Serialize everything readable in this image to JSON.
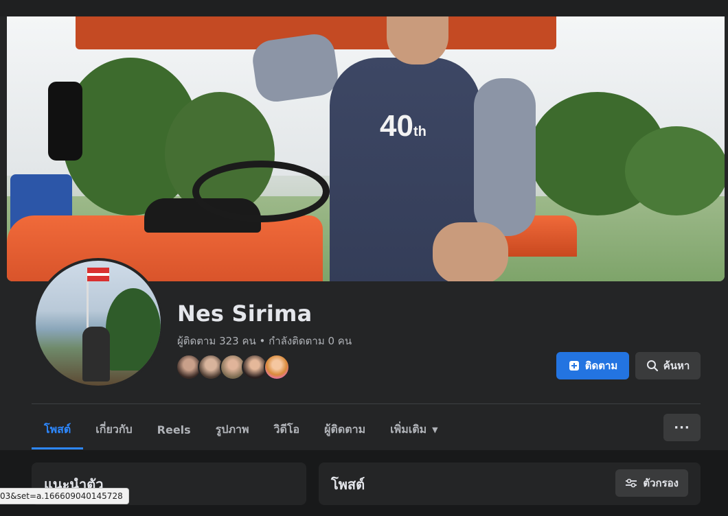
{
  "profile": {
    "name": "Nes Sirima",
    "follow_stats": "ผู้ติดตาม 323 คน • กำลังติดตาม 0 คน"
  },
  "actions": {
    "follow_label": "ติดตาม",
    "search_label": "ค้นหา"
  },
  "tabs": [
    {
      "label": "โพสต์",
      "active": true
    },
    {
      "label": "เกี่ยวกับ",
      "active": false
    },
    {
      "label": "Reels",
      "active": false
    },
    {
      "label": "รูปภาพ",
      "active": false
    },
    {
      "label": "วิดีโอ",
      "active": false
    },
    {
      "label": "ผู้ติดตาม",
      "active": false
    },
    {
      "label": "เพิ่มเติม",
      "active": false
    }
  ],
  "more_button_label": "···",
  "intro_card": {
    "title": "แนะนำตัว"
  },
  "posts_card": {
    "title": "โพสต์",
    "filter_label": "ตัวกรอง"
  },
  "status_url": "03&set=a.166609040145728",
  "colors": {
    "accent": "#2d88ff",
    "follow_button": "#2374e1",
    "background": "#242526"
  },
  "icons": {
    "follow": "user-plus-icon",
    "search": "search-icon",
    "filter": "sliders-icon",
    "dropdown": "caret-down-icon"
  }
}
